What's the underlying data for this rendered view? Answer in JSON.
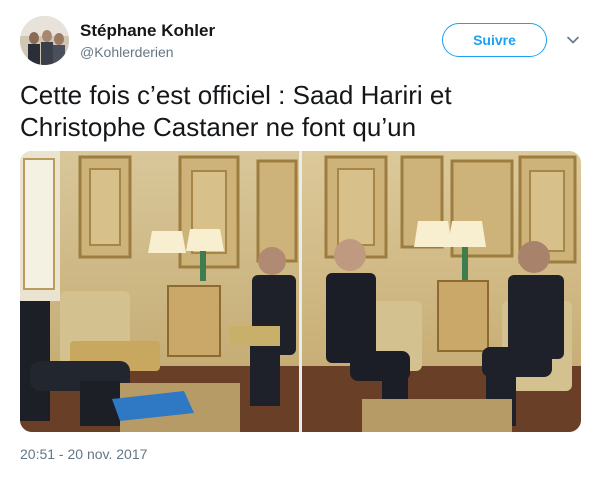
{
  "author": {
    "name": "Stéphane Kohler",
    "handle": "@Kohlerderien"
  },
  "follow_button": {
    "label": "Suivre"
  },
  "menu": {
    "icon": "chevron-down-icon"
  },
  "tweet": {
    "text": "Cette fois c’est officiel : Saad Hariri et Christophe Castaner ne font qu’un",
    "timestamp": "20:51 - 20 nov. 2017"
  },
  "media": {
    "photo_count": 2
  },
  "colors": {
    "accent": "#1da1f2",
    "secondary_text": "#657786",
    "primary_text": "#14171a"
  }
}
